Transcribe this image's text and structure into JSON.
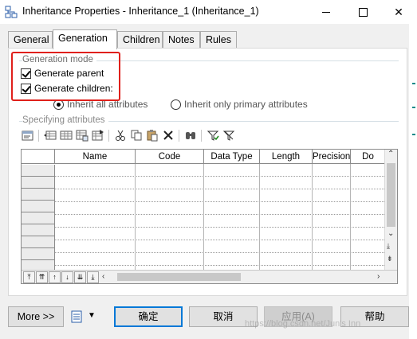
{
  "window": {
    "title": "Inheritance Properties - Inheritance_1 (Inheritance_1)",
    "close_glyph": "✕"
  },
  "tabs": [
    {
      "label": "General"
    },
    {
      "label": "Generation",
      "active": true
    },
    {
      "label": "Children"
    },
    {
      "label": "Notes"
    },
    {
      "label": "Rules"
    }
  ],
  "generation_mode": {
    "label": "Generation mode",
    "generate_parent": {
      "label": "Generate parent",
      "checked": true
    },
    "generate_children": {
      "label": "Generate children:",
      "checked": true
    },
    "inherit_all": {
      "label": "Inherit all attributes",
      "selected": true
    },
    "inherit_primary": {
      "label": "Inherit only primary attributes",
      "selected": false
    }
  },
  "specifying_attributes": {
    "label": "Specifying attributes",
    "toolbar": [
      "properties-icon",
      "insert-row-icon",
      "add-row-icon",
      "add-attributes-icon",
      "add-existing-icon",
      "cut-icon",
      "copy-icon",
      "paste-icon",
      "delete-icon",
      "find-icon",
      "filter-icon",
      "clear-filter-icon"
    ],
    "columns": [
      "Name",
      "Code",
      "Data Type",
      "Length",
      "Precision",
      "Do"
    ],
    "rows": [],
    "visible_empty_rows": 9
  },
  "buttons": {
    "more": "More >>",
    "ok": "确定",
    "cancel": "取消",
    "apply": "应用(A)",
    "help": "帮助"
  },
  "watermark": "https://blog.csdn.net/Jun's Inn",
  "colors": {
    "highlight_box": "#e0201b",
    "default_button_border": "#0078d7",
    "group_line": "#d5dfe5"
  }
}
